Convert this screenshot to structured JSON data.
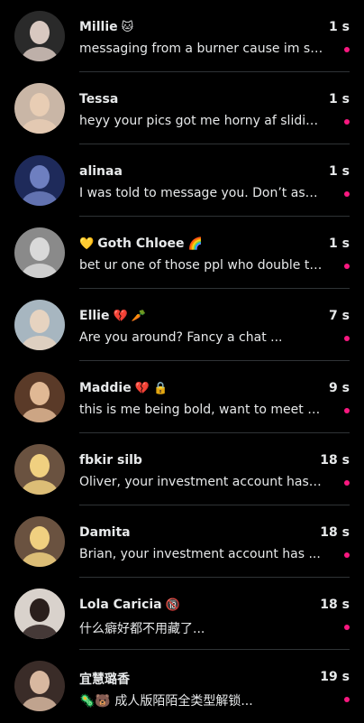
{
  "colors": {
    "background": "#000000",
    "text": "#e7e9ea",
    "divider": "#2f3336",
    "unread_dot": "#f91880"
  },
  "conversations": [
    {
      "name": "Millie",
      "name_emoji": "🐱",
      "lead_emoji": "",
      "time": "1 s",
      "preview": "messaging from a burner cause im sh...",
      "unread": true,
      "avatar_colors": [
        "#2a2a2a",
        "#d8c8c0"
      ]
    },
    {
      "name": "Tessa",
      "name_emoji": "",
      "lead_emoji": "",
      "time": "1 s",
      "preview": "heyy your pics got me horny af sliding...",
      "unread": true,
      "avatar_colors": [
        "#c9b6a6",
        "#e8cdb4"
      ]
    },
    {
      "name": "alinaa",
      "name_emoji": "",
      "lead_emoji": "",
      "time": "1 s",
      "preview": "I was told to message you. Don’t ask ...",
      "unread": true,
      "avatar_colors": [
        "#1e2a5a",
        "#6e7fc0"
      ]
    },
    {
      "name": "Goth Chloee",
      "name_emoji": "🌈",
      "lead_emoji": "💛",
      "time": "1 s",
      "preview": "bet ur one of those ppl who double te...",
      "unread": true,
      "avatar_colors": [
        "#8a8a8a",
        "#d9d9d9"
      ]
    },
    {
      "name": "Ellie",
      "name_emoji": "💔 🥕",
      "lead_emoji": "",
      "time": "7 s",
      "preview": "Are you around? Fancy a chat ...",
      "unread": true,
      "avatar_colors": [
        "#a7b6c0",
        "#e6d3c0"
      ]
    },
    {
      "name": "Maddie",
      "name_emoji": "💔 🔒",
      "lead_emoji": "",
      "time": "9 s",
      "preview": "this is me being bold, want to meet u...",
      "unread": true,
      "avatar_colors": [
        "#5a3a28",
        "#e0b894"
      ]
    },
    {
      "name": "fbkir silb",
      "name_emoji": "",
      "lead_emoji": "",
      "time": "18 s",
      "preview": "Oliver, your investment account has ...",
      "unread": true,
      "avatar_colors": [
        "#6a5240",
        "#f0d080"
      ]
    },
    {
      "name": "Damita",
      "name_emoji": "",
      "lead_emoji": "",
      "time": "18 s",
      "preview": "Brian, your investment account has ...",
      "unread": true,
      "avatar_colors": [
        "#6a5240",
        "#f0d080"
      ]
    },
    {
      "name": "Lola Caricia",
      "name_emoji": "🔞",
      "lead_emoji": "",
      "time": "18 s",
      "preview": "什么癖好都不用藏了...",
      "unread": true,
      "avatar_colors": [
        "#d9d2cc",
        "#2a1f1c"
      ]
    },
    {
      "name": "宜慧璐香",
      "name_emoji": "",
      "lead_emoji": "",
      "time": "19 s",
      "preview": "🦠🐻 成人版陌陌全类型解锁...",
      "unread": true,
      "avatar_colors": [
        "#3a2c28",
        "#d8b8a0"
      ]
    }
  ]
}
